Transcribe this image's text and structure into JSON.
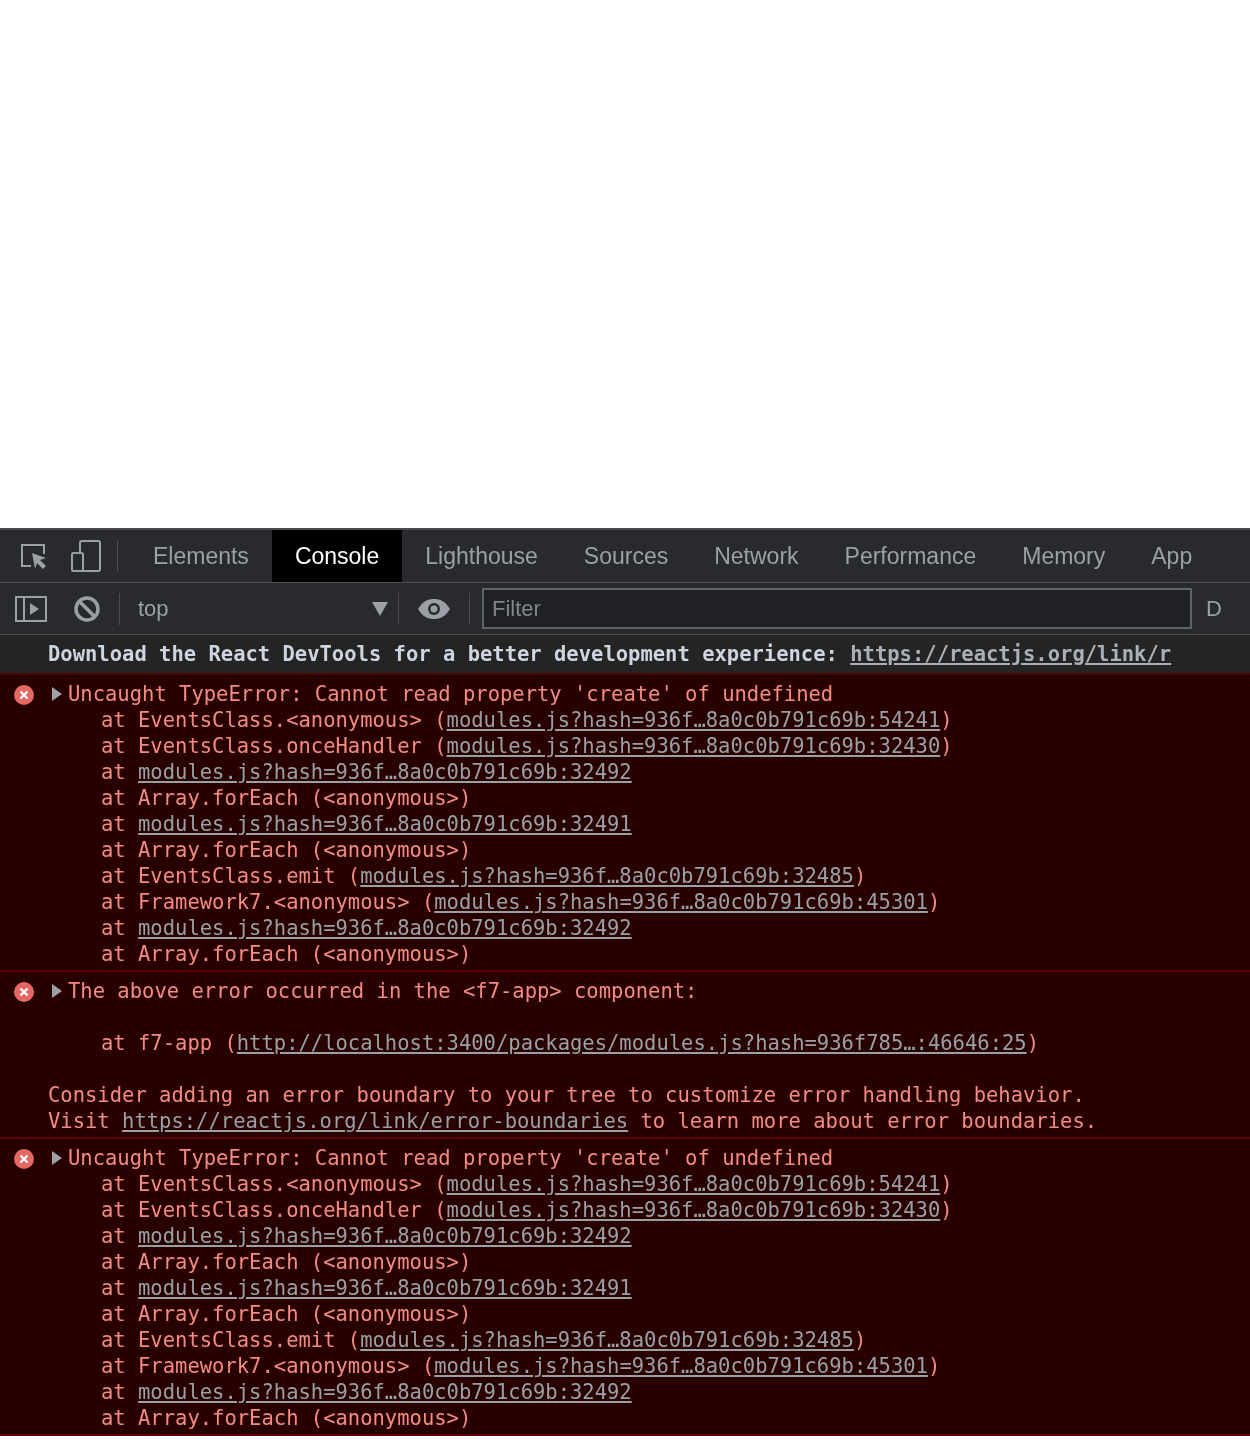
{
  "devtools": {
    "tabs": [
      {
        "label": "Elements",
        "selected": false
      },
      {
        "label": "Console",
        "selected": true
      },
      {
        "label": "Lighthouse",
        "selected": false
      },
      {
        "label": "Sources",
        "selected": false
      },
      {
        "label": "Network",
        "selected": false
      },
      {
        "label": "Performance",
        "selected": false
      },
      {
        "label": "Memory",
        "selected": false
      },
      {
        "label": "App",
        "selected": false
      }
    ],
    "toolbar": {
      "context": "top",
      "filter": {
        "placeholder": "Filter"
      },
      "levels": "D"
    },
    "messages": [
      {
        "kind": "info",
        "prefix": "Download the React DevTools for a better development experience: ",
        "link": "https://reactjs.org/link/r"
      },
      {
        "kind": "error",
        "expanded": false,
        "header": "Uncaught TypeError: Cannot read property 'create' of undefined",
        "lines": [
          {
            "kind": "frame",
            "prefix": "at EventsClass.<anonymous> (",
            "link": "modules.js?hash=936f…8a0c0b791c69b:54241",
            "suffix": ")"
          },
          {
            "kind": "frame",
            "prefix": "at EventsClass.onceHandler (",
            "link": "modules.js?hash=936f…8a0c0b791c69b:32430",
            "suffix": ")"
          },
          {
            "kind": "frame",
            "prefix": "at ",
            "link": "modules.js?hash=936f…8a0c0b791c69b:32492"
          },
          {
            "kind": "frame",
            "prefix": "at Array.forEach (<anonymous>)"
          },
          {
            "kind": "frame",
            "prefix": "at ",
            "link": "modules.js?hash=936f…8a0c0b791c69b:32491"
          },
          {
            "kind": "frame",
            "prefix": "at Array.forEach (<anonymous>)"
          },
          {
            "kind": "frame",
            "prefix": "at EventsClass.emit (",
            "link": "modules.js?hash=936f…8a0c0b791c69b:32485",
            "suffix": ")"
          },
          {
            "kind": "frame",
            "prefix": "at Framework7.<anonymous> (",
            "link": "modules.js?hash=936f…8a0c0b791c69b:45301",
            "suffix": ")"
          },
          {
            "kind": "frame",
            "prefix": "at ",
            "link": "modules.js?hash=936f…8a0c0b791c69b:32492"
          },
          {
            "kind": "frame",
            "prefix": "at Array.forEach (<anonymous>)"
          }
        ]
      },
      {
        "kind": "error",
        "expanded": false,
        "header": "The above error occurred in the <f7-app> component:",
        "lines": [
          {
            "kind": "gap"
          },
          {
            "kind": "frame",
            "prefix": "at f7-app (",
            "link": "http://localhost:3400/packages/modules.js?hash=936f785…:46646:25",
            "suffix": ")"
          },
          {
            "kind": "gap"
          },
          {
            "kind": "text",
            "prefix": "Consider adding an error boundary to your tree to customize error handling behavior."
          },
          {
            "kind": "text",
            "prefix": "Visit ",
            "link": "https://reactjs.org/link/error-boundaries",
            "suffix": " to learn more about error boundaries."
          }
        ]
      },
      {
        "kind": "error",
        "expanded": false,
        "header": "Uncaught TypeError: Cannot read property 'create' of undefined",
        "lines": [
          {
            "kind": "frame",
            "prefix": "at EventsClass.<anonymous> (",
            "link": "modules.js?hash=936f…8a0c0b791c69b:54241",
            "suffix": ")"
          },
          {
            "kind": "frame",
            "prefix": "at EventsClass.onceHandler (",
            "link": "modules.js?hash=936f…8a0c0b791c69b:32430",
            "suffix": ")"
          },
          {
            "kind": "frame",
            "prefix": "at ",
            "link": "modules.js?hash=936f…8a0c0b791c69b:32492"
          },
          {
            "kind": "frame",
            "prefix": "at Array.forEach (<anonymous>)"
          },
          {
            "kind": "frame",
            "prefix": "at ",
            "link": "modules.js?hash=936f…8a0c0b791c69b:32491"
          },
          {
            "kind": "frame",
            "prefix": "at Array.forEach (<anonymous>)"
          },
          {
            "kind": "frame",
            "prefix": "at EventsClass.emit (",
            "link": "modules.js?hash=936f…8a0c0b791c69b:32485",
            "suffix": ")"
          },
          {
            "kind": "frame",
            "prefix": "at Framework7.<anonymous> (",
            "link": "modules.js?hash=936f…8a0c0b791c69b:45301",
            "suffix": ")"
          },
          {
            "kind": "frame",
            "prefix": "at ",
            "link": "modules.js?hash=936f…8a0c0b791c69b:32492"
          },
          {
            "kind": "frame",
            "prefix": "at Array.forEach (<anonymous>)"
          }
        ]
      }
    ]
  }
}
